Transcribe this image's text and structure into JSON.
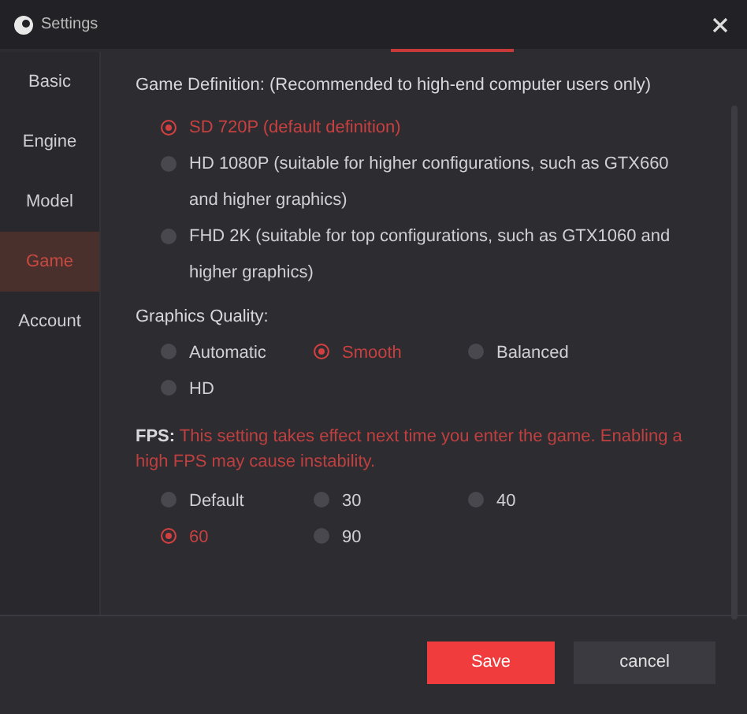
{
  "window": {
    "title": "Settings"
  },
  "sidebar": {
    "items": [
      {
        "label": "Basic",
        "selected": false
      },
      {
        "label": "Engine",
        "selected": false
      },
      {
        "label": "Model",
        "selected": false
      },
      {
        "label": "Game",
        "selected": true
      },
      {
        "label": "Account",
        "selected": false
      }
    ]
  },
  "definition": {
    "label": "Game Definition: (Recommended to high-end computer users only)",
    "options": [
      {
        "label": "SD 720P (default definition)",
        "selected": true
      },
      {
        "label": "HD 1080P (suitable for higher configurations, such as GTX660 and higher graphics)",
        "selected": false
      },
      {
        "label": "FHD 2K (suitable for top configurations, such as GTX1060 and higher graphics)",
        "selected": false
      }
    ]
  },
  "quality": {
    "label": "Graphics Quality:",
    "options": [
      {
        "label": "Automatic",
        "selected": false
      },
      {
        "label": "Smooth",
        "selected": true
      },
      {
        "label": "Balanced",
        "selected": false
      },
      {
        "label": "HD",
        "selected": false
      }
    ]
  },
  "fps": {
    "label": "FPS:",
    "note": "This setting takes effect next time you enter the game. Enabling a high FPS may cause instability.",
    "options": [
      {
        "label": "Default",
        "selected": false
      },
      {
        "label": "30",
        "selected": false
      },
      {
        "label": "40",
        "selected": false
      },
      {
        "label": "60",
        "selected": true
      },
      {
        "label": "90",
        "selected": false
      }
    ]
  },
  "buttons": {
    "save": "Save",
    "cancel": "cancel"
  }
}
